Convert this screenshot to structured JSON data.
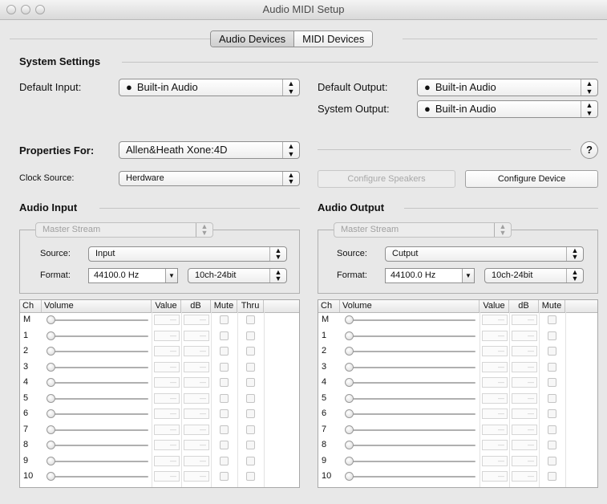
{
  "window": {
    "title": "Audio MIDI Setup"
  },
  "tabs": [
    {
      "label": "Audio Devices",
      "selected": true
    },
    {
      "label": "MIDI Devices",
      "selected": false
    }
  ],
  "system_settings": {
    "heading": "System Settings",
    "default_input": {
      "label": "Default Input:",
      "value": "Built-in Audio"
    },
    "default_output": {
      "label": "Default Output:",
      "value": "Built-in Audio"
    },
    "system_output": {
      "label": "System Output:",
      "value": "Built-in Audio"
    }
  },
  "properties": {
    "label": "Properties For:",
    "device": "Allen&Heath Xone:4D",
    "help": "?",
    "clock_label": "Clock Source:",
    "clock_value": "Herdware",
    "configure_speakers": "Configure Speakers",
    "configure_device": "Configure Device"
  },
  "audio_input": {
    "heading": "Audio Input",
    "stream": "Master Stream",
    "source_label": "Source:",
    "source": "Input",
    "format_label": "Format:",
    "rate": "44100.0 Hz",
    "bits": "10ch-24bit",
    "columns": [
      "Ch",
      "Volume",
      "Value",
      "dB",
      "Mute",
      "Thru"
    ],
    "channels": [
      "M",
      "1",
      "2",
      "3",
      "4",
      "5",
      "6",
      "7",
      "8",
      "9",
      "10"
    ]
  },
  "audio_output": {
    "heading": "Audio Output",
    "stream": "Master Stream",
    "source_label": "Source:",
    "source": "Cutput",
    "format_label": "Format:",
    "rate": "44100.0 Hz",
    "bits": "10ch-24bit",
    "columns": [
      "Ch",
      "Volume",
      "Value",
      "dB",
      "Mute"
    ],
    "channels": [
      "M",
      "1",
      "2",
      "3",
      "4",
      "5",
      "6",
      "7",
      "8",
      "9",
      "10"
    ]
  },
  "empty_cell": "—",
  "icons": {
    "apple": "apple-icon",
    "stepper": "up-down-arrows-icon",
    "dropdown": "triangle-down-icon"
  }
}
